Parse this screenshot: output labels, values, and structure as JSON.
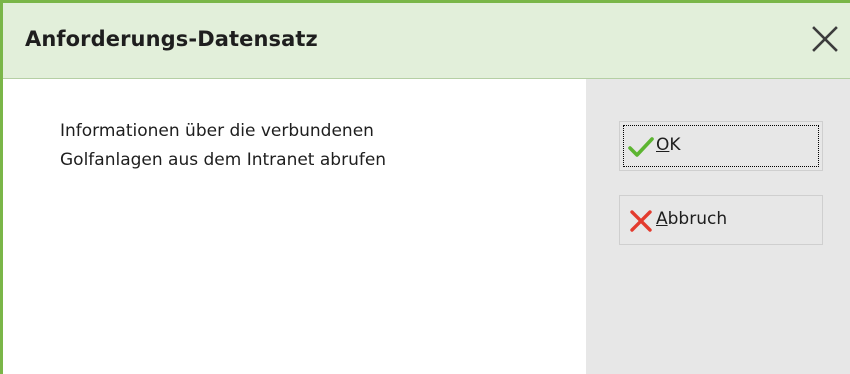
{
  "dialog": {
    "title": "Anforderungs-Datensatz",
    "accent_color": "#7ab648",
    "title_bg_color": "#e2efda"
  },
  "message": {
    "line1": "Informationen über die verbundenen",
    "line2": "Golfanlagen aus dem Intranet abrufen"
  },
  "buttons": {
    "ok": {
      "mnemonic": "O",
      "rest": "K",
      "icon": "checkmark-icon",
      "icon_color": "#5cb531",
      "focused": true
    },
    "cancel": {
      "mnemonic": "A",
      "rest": "bbruch",
      "icon": "x-cross-icon",
      "icon_color": "#e33b2e"
    }
  },
  "close_icon": "close-icon"
}
